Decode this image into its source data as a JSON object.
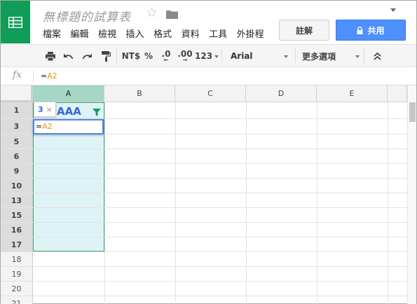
{
  "app": {
    "doc_title": "無標題的試算表",
    "brand_color": "#0f9d58",
    "accent_color": "#4d90fe"
  },
  "menu": [
    "檔案",
    "編輯",
    "檢視",
    "插入",
    "格式",
    "資料",
    "工具",
    "外掛程式"
  ],
  "header_buttons": {
    "comment_label": "註解",
    "share_label": "共用"
  },
  "toolbar": {
    "currency_label": "NT$",
    "percent_label": "%",
    "decrease_decimal_label": ".0",
    "increase_decimal_label": ".00",
    "number_format_label": "123",
    "font_name": "Arial",
    "more_label": "更多選項"
  },
  "formula_bar": {
    "fx_label": "fx",
    "eq": "=",
    "ref": "A2"
  },
  "grid": {
    "columns": [
      "A",
      "B",
      "C",
      "D",
      "E"
    ],
    "rows": [
      "1",
      "3",
      "5",
      "6",
      "9",
      "10",
      "13",
      "15",
      "16",
      "17",
      "18",
      "19",
      "20",
      "21"
    ],
    "header_cell_text": "AAA",
    "edit_cell_eq": "=",
    "edit_cell_ref": "A2",
    "tooltip_number": "3",
    "tooltip_close": "×"
  }
}
